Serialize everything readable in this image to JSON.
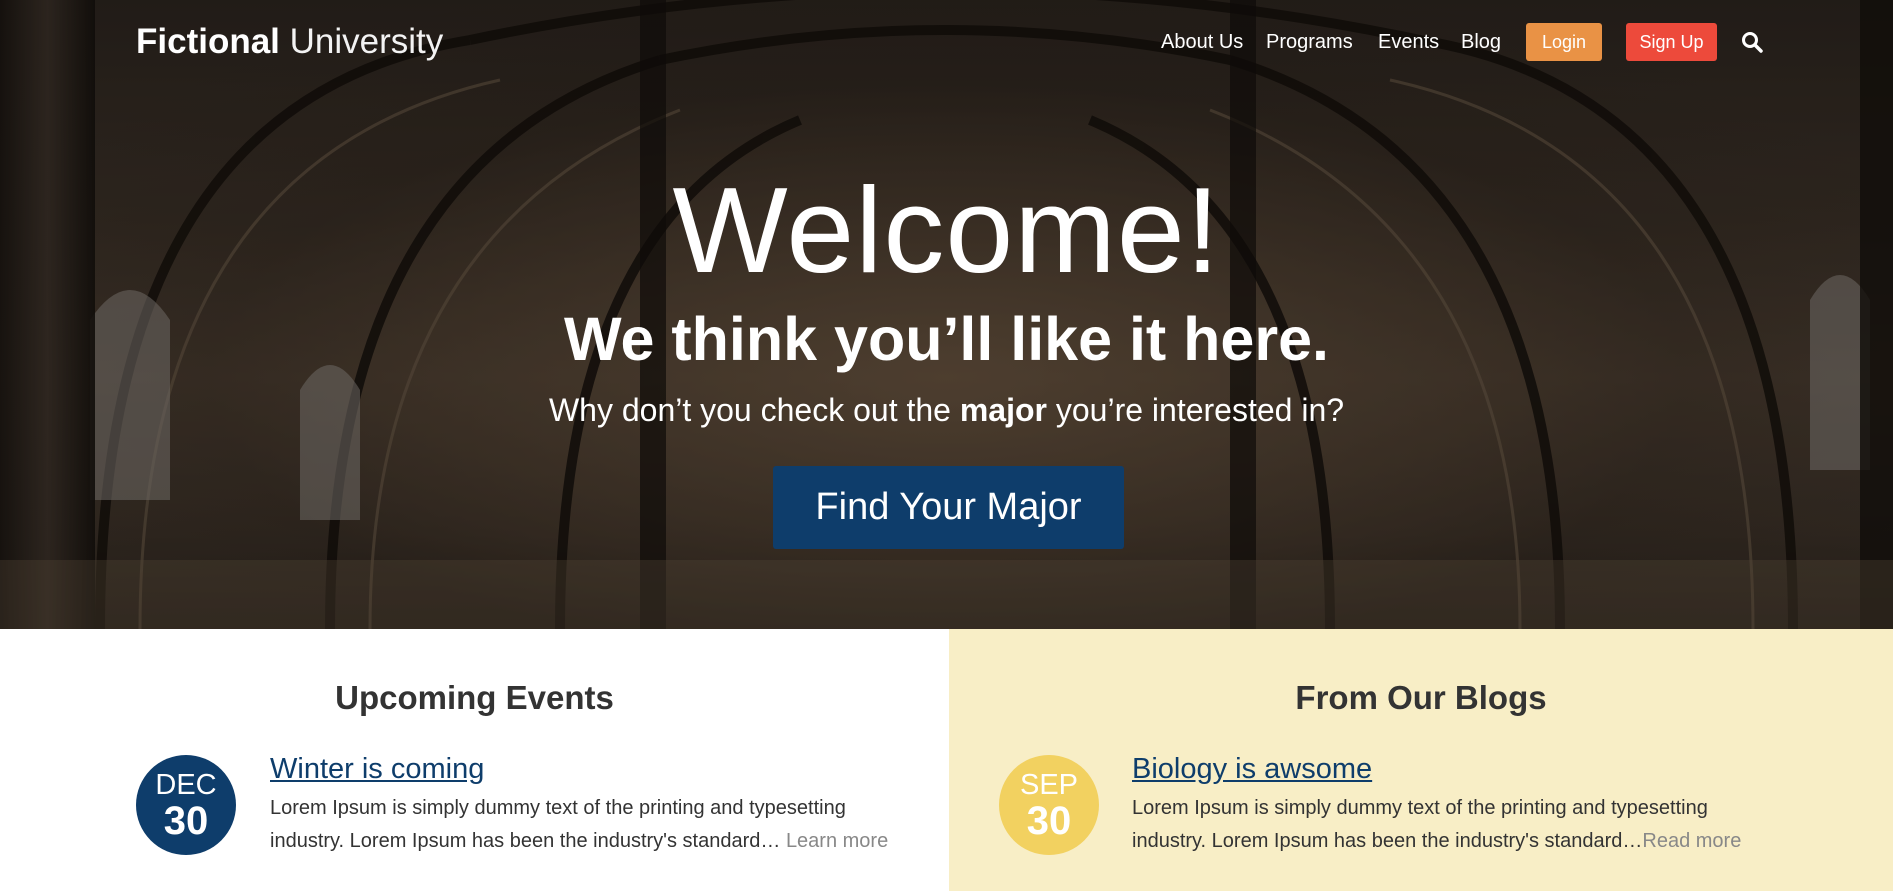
{
  "header": {
    "logo_bold": "Fictional",
    "logo_light": "University",
    "nav": [
      "About Us",
      "Programs",
      "Events",
      "Blog"
    ],
    "login_label": "Login",
    "signup_label": "Sign Up",
    "search_icon": "search-icon"
  },
  "hero": {
    "welcome": "Welcome!",
    "tagline": "We think you’ll like it here.",
    "subline_before": "Why don’t you check out the ",
    "subline_bold": "major",
    "subline_after": " you’re interested in?",
    "cta_label": "Find Your Major"
  },
  "events": {
    "title": "Upcoming Events",
    "item": {
      "month": "DEC",
      "day": "30",
      "title": "Winter is coming",
      "body": "Lorem Ipsum is simply dummy text of the printing and typesetting industry. Lorem Ipsum has been the industry's standard… ",
      "more": "Learn more"
    }
  },
  "blogs": {
    "title": "From Our Blogs",
    "item": {
      "month": "SEP",
      "day": "30",
      "title": "Biology is awsome",
      "body": "Lorem Ipsum is simply dummy text of the printing and typesetting industry. Lorem Ipsum has been the industry's standard…",
      "more": "Read more"
    }
  },
  "colors": {
    "primary_blue": "#0e3d6b",
    "login_orange": "#e99245",
    "signup_red": "#ed4a3b",
    "blog_bg": "#f8eec6",
    "blog_circle": "#f2d160"
  }
}
